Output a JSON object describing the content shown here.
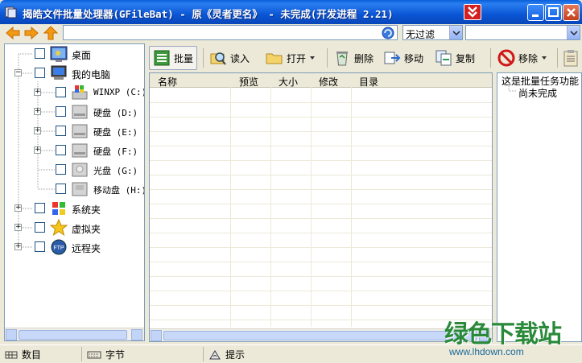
{
  "window": {
    "title": "揭皓文件批量处理器(GFileBat) - 原《灵者更名》 - 未完成(开发进程 2.21)"
  },
  "address": {
    "path_value": "",
    "filter_value": "无过滤",
    "search_value": ""
  },
  "tree": {
    "items": [
      {
        "label": "桌面",
        "icon": "desktop-icon"
      },
      {
        "label": "我的电脑",
        "icon": "computer-icon"
      },
      {
        "label": "WINXP (C:)",
        "icon": "windows-drive-icon"
      },
      {
        "label": "硬盘 (D:)",
        "icon": "hard-drive-icon"
      },
      {
        "label": "硬盘 (E:)",
        "icon": "hard-drive-icon"
      },
      {
        "label": "硬盘 (F:)",
        "icon": "hard-drive-icon"
      },
      {
        "label": "光盘 (G:)",
        "icon": "cd-drive-icon"
      },
      {
        "label": "移动盘 (H:)",
        "icon": "removable-drive-icon"
      },
      {
        "label": "系统夹",
        "icon": "windows-folder-icon"
      },
      {
        "label": "虚拟夹",
        "icon": "star-icon"
      },
      {
        "label": "远程夹",
        "icon": "ftp-icon"
      }
    ]
  },
  "toolbar": {
    "batch": "批量",
    "read": "读入",
    "open": "打开",
    "delete": "删除",
    "move": "移动",
    "copy": "复制",
    "remove": "移除"
  },
  "filelist": {
    "columns": [
      "名称",
      "预览",
      "大小",
      "修改",
      "目录"
    ]
  },
  "description": {
    "line1": "这是批量任务功能",
    "line2": "尚未完成"
  },
  "status": {
    "count": "数目",
    "bytes": "字节",
    "hint": "提示"
  },
  "watermark": {
    "text": "绿色下载站",
    "url": "www.lhdown.com"
  },
  "colors": {
    "titlebar": "#0b56d6",
    "accent_red": "#d42020"
  }
}
